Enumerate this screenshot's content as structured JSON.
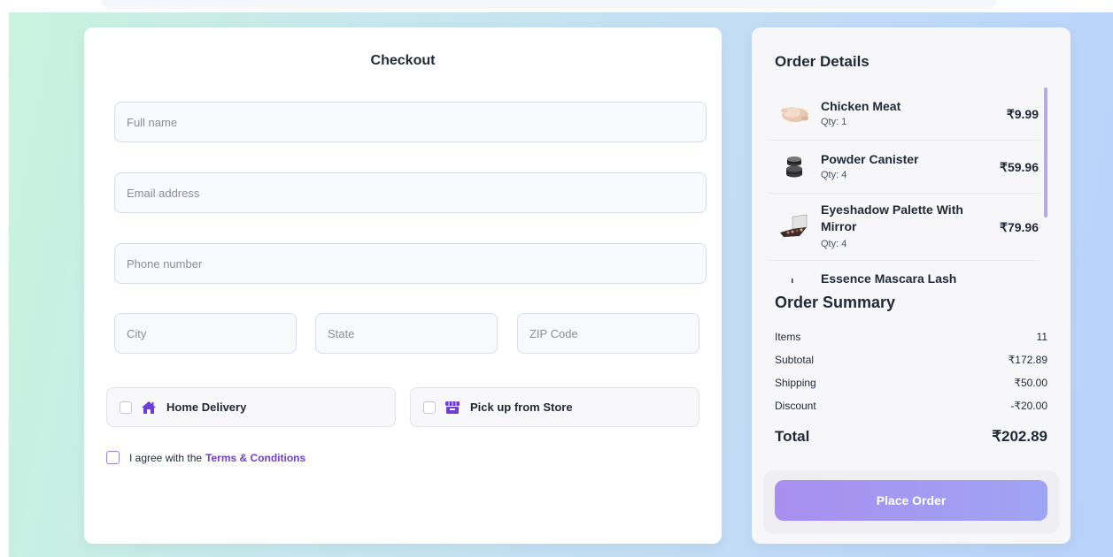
{
  "checkout": {
    "title": "Checkout",
    "fields": {
      "full_name": "Full name",
      "email": "Email address",
      "phone": "Phone number",
      "city": "City",
      "state": "State",
      "zip": "ZIP Code"
    },
    "delivery_options": [
      {
        "label": "Home Delivery",
        "icon": "home-icon",
        "selected": false
      },
      {
        "label": "Pick up from Store",
        "icon": "store-icon",
        "selected": false
      }
    ],
    "agree_text": "I agree with the",
    "terms_link": "Terms & Conditions"
  },
  "order_details": {
    "title": "Order Details",
    "items": [
      {
        "name": "Chicken Meat",
        "qty": "Qty: 1",
        "price": "₹9.99",
        "icon": "chicken-meat-image"
      },
      {
        "name": "Powder Canister",
        "qty": "Qty: 4",
        "price": "₹59.96",
        "icon": "powder-canister-image"
      },
      {
        "name": "Eyeshadow Palette With Mirror",
        "qty": "Qty: 4",
        "price": "₹79.96",
        "icon": "eyeshadow-palette-image"
      },
      {
        "name": "Essence Mascara Lash",
        "qty": "",
        "price": "",
        "icon": "mascara-image"
      }
    ]
  },
  "order_summary": {
    "title": "Order Summary",
    "rows": [
      {
        "label": "Items",
        "value": "11"
      },
      {
        "label": "Subtotal",
        "value": "₹172.89"
      },
      {
        "label": "Shipping",
        "value": "₹50.00"
      },
      {
        "label": "Discount",
        "value": "-₹20.00"
      }
    ],
    "total_label": "Total",
    "total_value": "₹202.89",
    "place_order_label": "Place Order"
  },
  "colors": {
    "accent": "#6d3fd6",
    "button_gradient_start": "#a88ef0",
    "button_gradient_end": "#9fa4f4"
  }
}
